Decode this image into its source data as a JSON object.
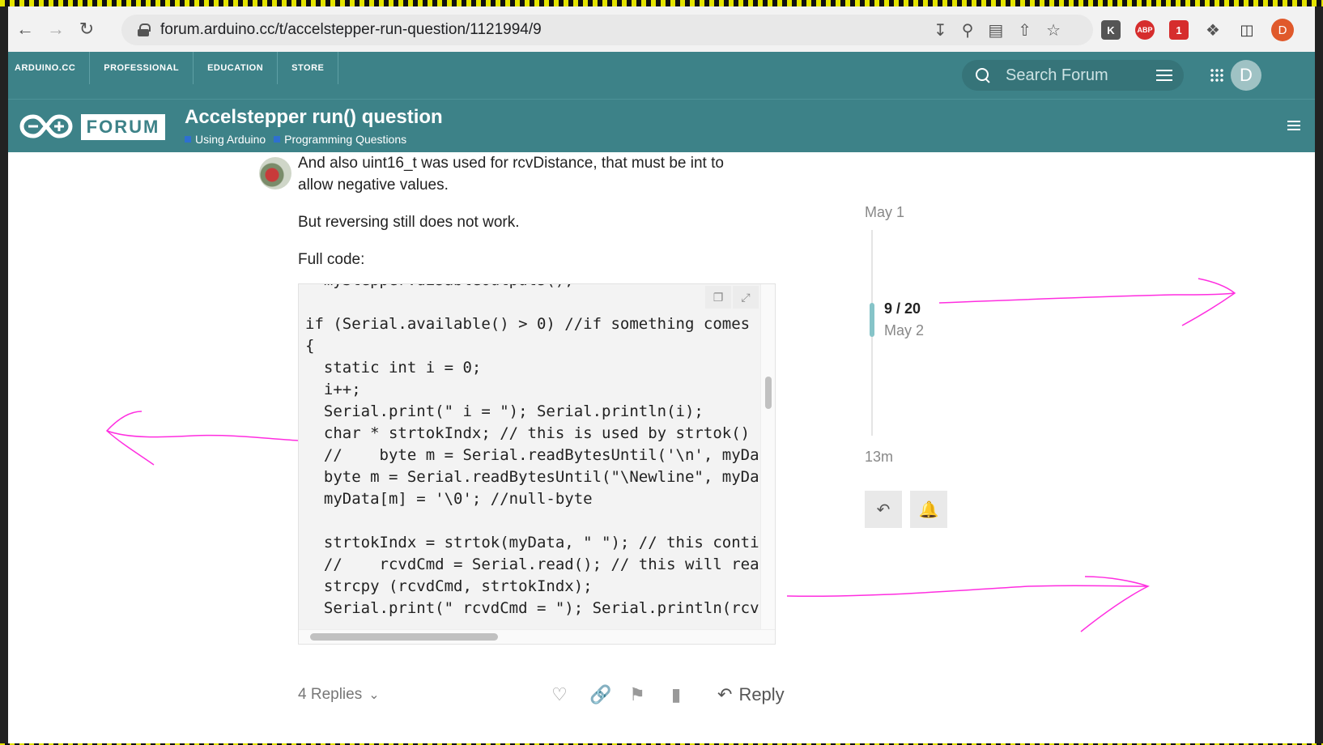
{
  "browser": {
    "url": "forum.arduino.cc/t/accelstepper-run-question/1121994/9",
    "profile_initial": "D",
    "ext_k": "K",
    "ext_abp": "ABP",
    "ext_badge": "1"
  },
  "topnav": {
    "links": [
      "ARDUINO.CC",
      "PROFESSIONAL",
      "EDUCATION",
      "STORE"
    ],
    "search_placeholder": "Search Forum",
    "avatar_initial": "D"
  },
  "forum": {
    "logo_text": "FORUM",
    "topic_title": "Accelstepper run() question",
    "categories": [
      "Using Arduino",
      "Programming Questions"
    ]
  },
  "post": {
    "paragraph1_line1": "And also uint16_t was used for rcvDistance, that must be int to",
    "paragraph1_line2": "allow negative values.",
    "paragraph2": "But reversing still does not work.",
    "paragraph3": "Full code:",
    "code_lines": [
      "  myStepper.disableOutputs();",
      "",
      "if (Serial.available() > 0) //if something comes",
      "{",
      "  static int i = 0;",
      "  i++;",
      "  Serial.print(\" i = \"); Serial.println(i);",
      "  char * strtokIndx; // this is used by strtok()",
      "  //    byte m = Serial.readBytesUntil('\\n', myDa",
      "  byte m = Serial.readBytesUntil(\"\\Newline\", myDa",
      "  myData[m] = '\\0'; //null-byte",
      "",
      "  strtokIndx = strtok(myData, \" \"); // this conti",
      "  //    rcvdCmd = Serial.read(); // this will rea",
      "  strcpy (rcvdCmd, strtokIndx);",
      "  Serial.print(\" rcvdCmd = \"); Serial.println(rcv"
    ],
    "replies_label": "4 Replies",
    "reply_label": "Reply"
  },
  "timeline": {
    "top_date": "May 1",
    "position": "9 / 20",
    "current_date": "May 2",
    "bottom_label": "13m"
  },
  "colors": {
    "brand": "#3d8288",
    "annotation": "#ff2ee0"
  }
}
